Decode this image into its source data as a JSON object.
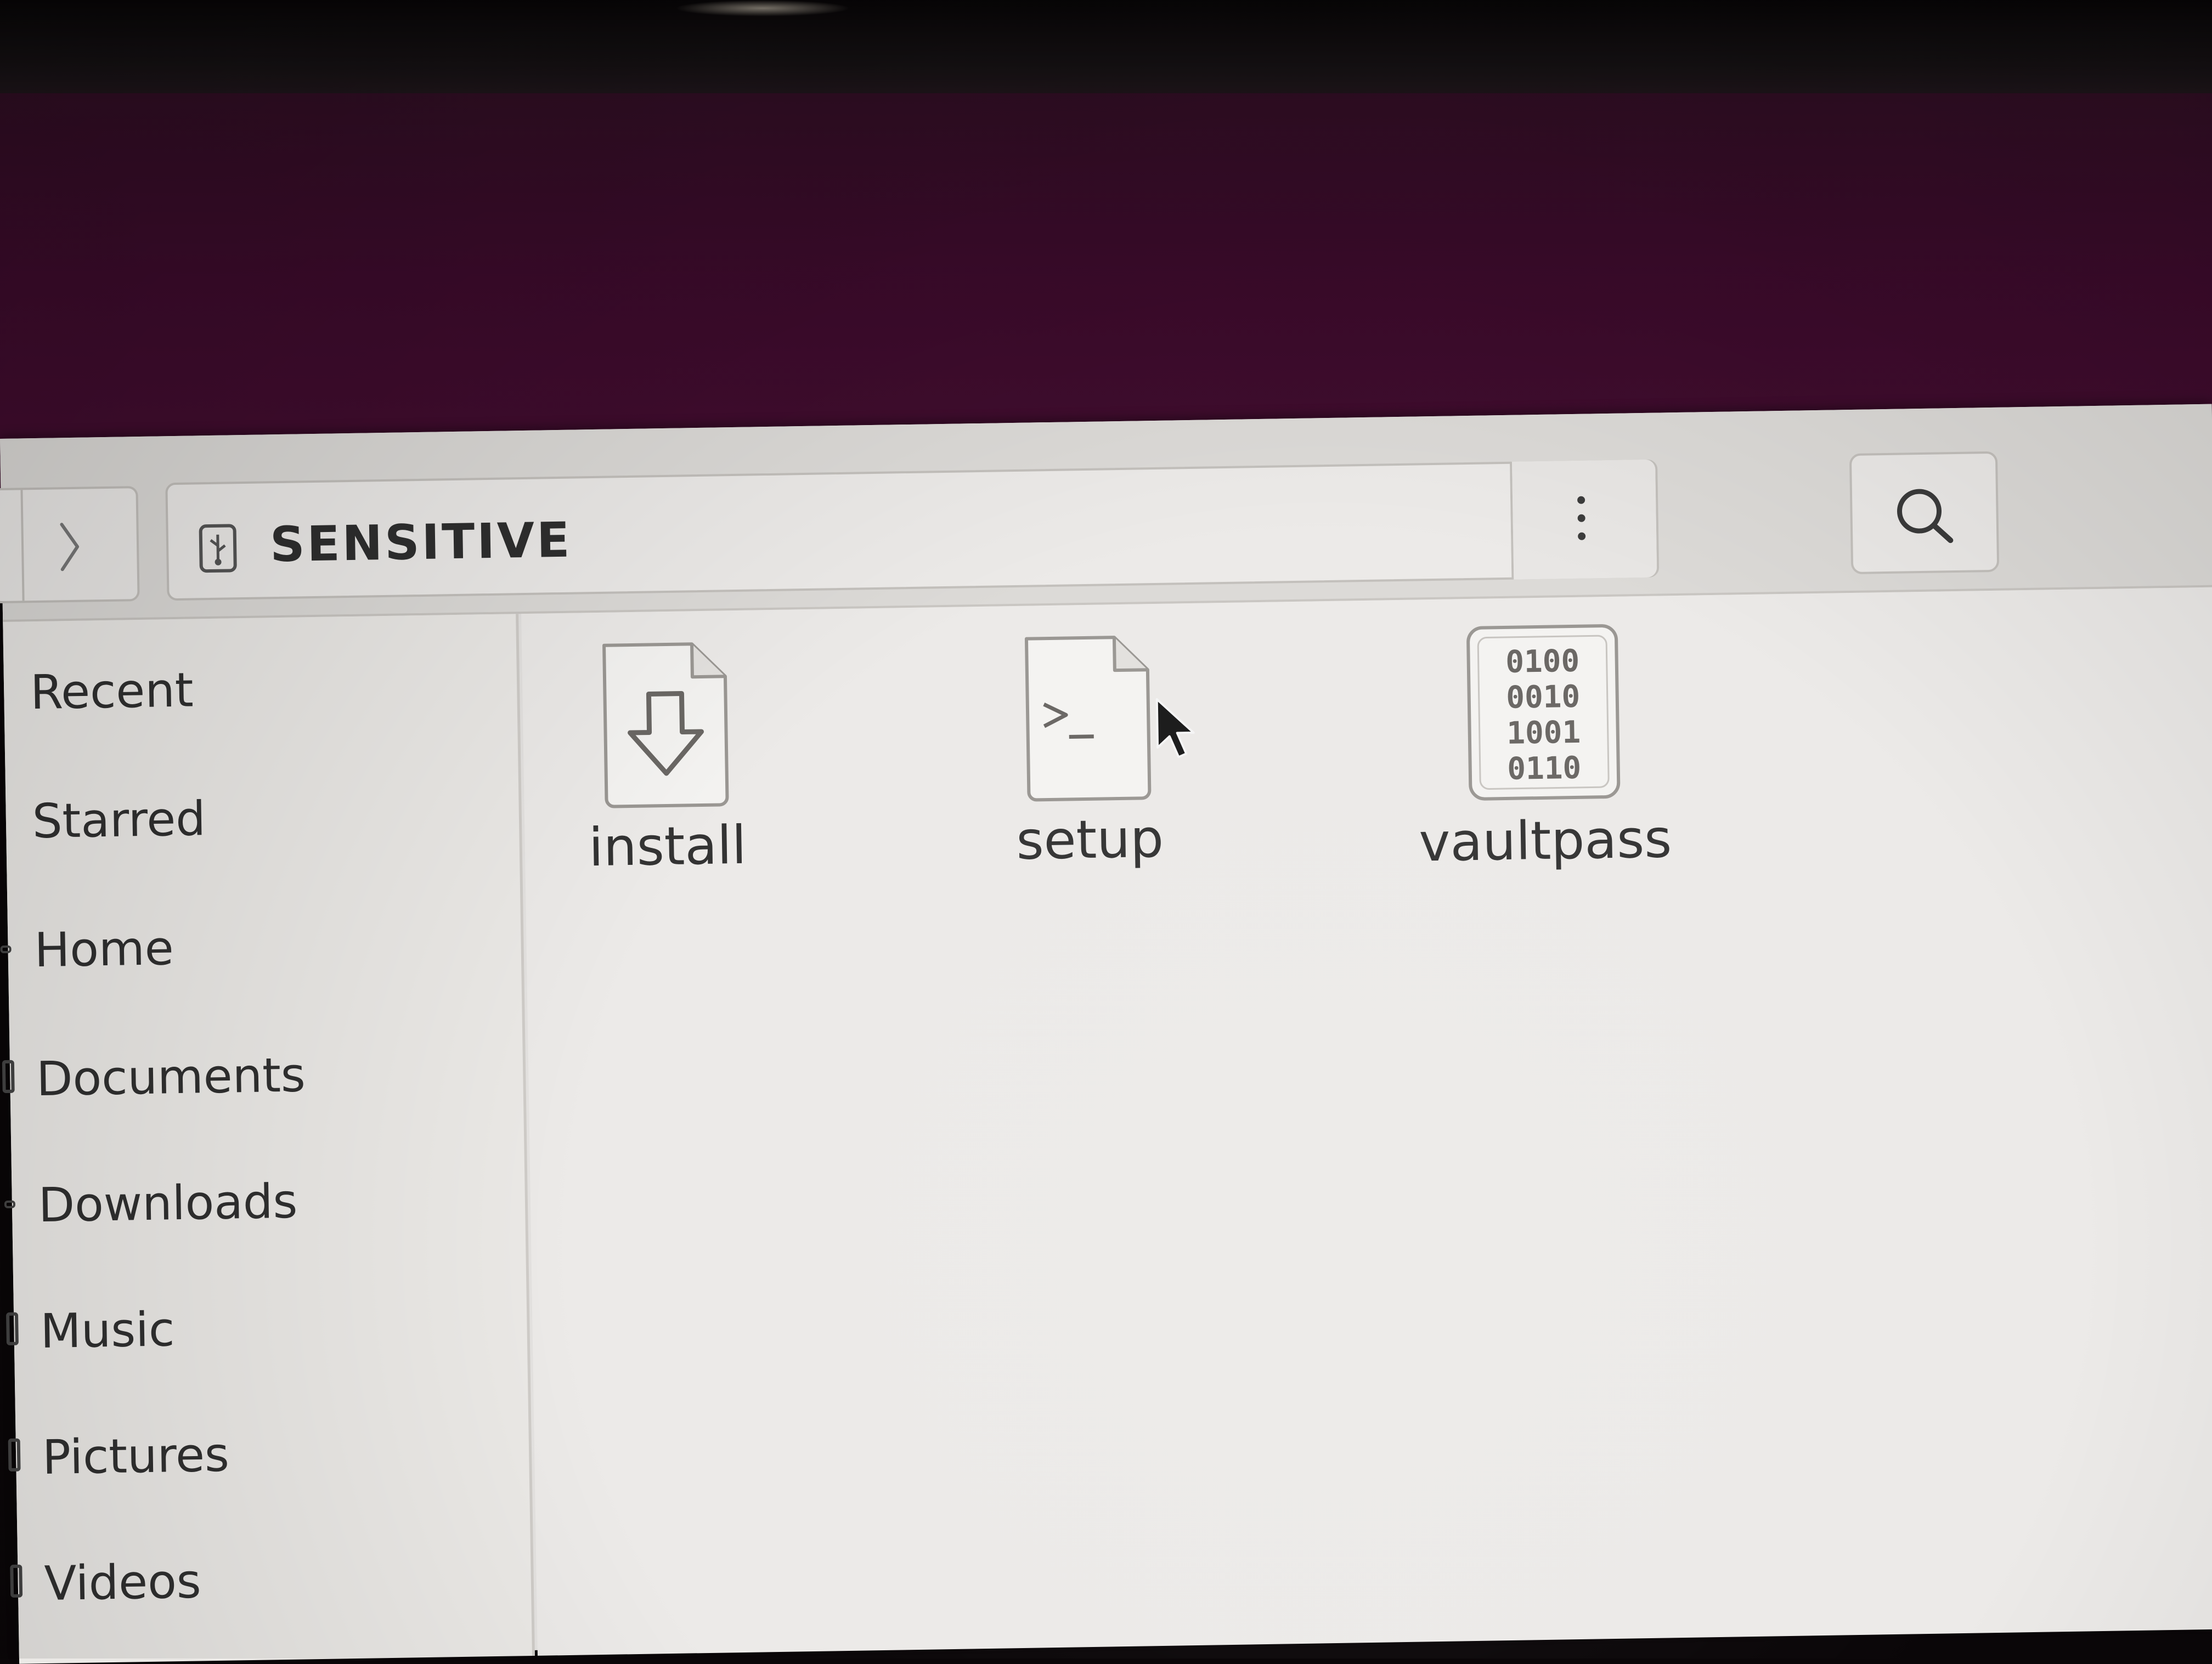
{
  "header": {
    "path_label": "SENSITIVE",
    "path_icon": "usb-drive-icon",
    "forward_icon": "chevron-right-icon",
    "menu_icon": "vertical-ellipsis-icon",
    "search_icon": "search-icon"
  },
  "sidebar": {
    "items": [
      {
        "label": "Recent",
        "icon": "clock-icon"
      },
      {
        "label": "Starred",
        "icon": "star-icon"
      },
      {
        "label": "Home",
        "icon": "home-icon"
      },
      {
        "label": "Documents",
        "icon": "documents-icon"
      },
      {
        "label": "Downloads",
        "icon": "downloads-icon"
      },
      {
        "label": "Music",
        "icon": "music-icon"
      },
      {
        "label": "Pictures",
        "icon": "pictures-icon"
      },
      {
        "label": "Videos",
        "icon": "videos-icon"
      }
    ]
  },
  "files": [
    {
      "name": "install",
      "icon": "installer-file-icon"
    },
    {
      "name": "setup",
      "icon": "script-file-icon"
    },
    {
      "name": "vaultpass",
      "icon": "binary-file-icon",
      "binary_text": [
        "0100",
        "0010",
        "1001",
        "0110"
      ]
    }
  ],
  "colors": {
    "desktop": "#3a0a2a",
    "window": "#eceae8",
    "text": "#2f2f2f"
  }
}
